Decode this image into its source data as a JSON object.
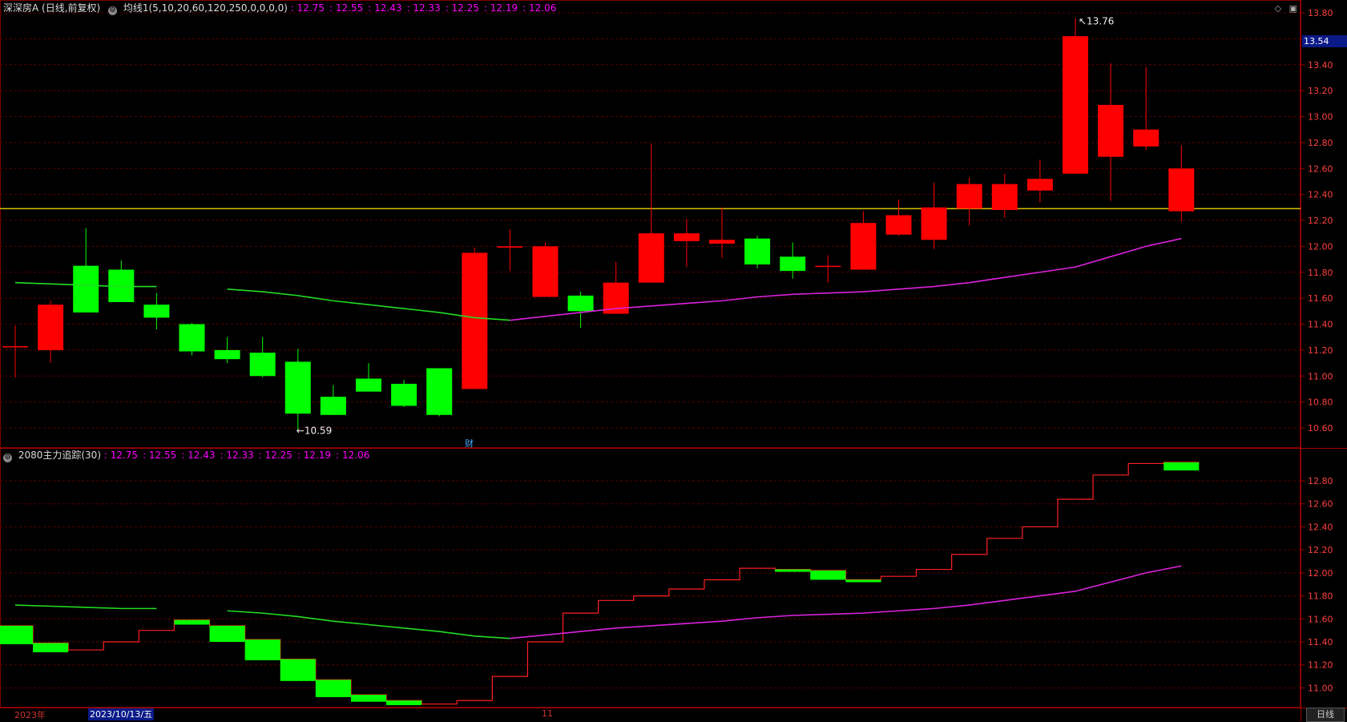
{
  "header": {
    "stock_title": "深深房A (日线,前复权)",
    "ma_label": "均线1(5,10,20,60,120,250,0,0,0,0)",
    "ma_values": [
      ": 12.75",
      ": 12.55",
      ": 12.43",
      ": 12.33",
      ": 12.25",
      ": 12.19",
      ": 12.06"
    ]
  },
  "sub_header": {
    "indicator_label": "2080主力追踪(30)",
    "values": [
      ": 12.75",
      ": 12.55",
      ": 12.43",
      ": 12.33",
      ": 12.25",
      ": 12.19",
      ": 12.06"
    ]
  },
  "price_badge": "13.54",
  "high_marker": "13.76",
  "low_marker": "10.59",
  "finance_mark": "财",
  "footer": {
    "year": "2023年",
    "date": "2023/10/13/五",
    "month": "11",
    "period": "日线"
  },
  "colors": {
    "up": "#ff0000",
    "down": "#00ff00",
    "ma_green": "#22dd22",
    "ma_magenta": "#dd22dd",
    "hline": "#d8c000",
    "grid": "#5a0000",
    "axis_text": "#ff4040"
  },
  "chart_data": [
    {
      "type": "candlestick",
      "y_ticks": [
        "13.80",
        "13.60",
        "13.40",
        "13.20",
        "13.00",
        "12.80",
        "12.60",
        "12.40",
        "12.20",
        "12.00",
        "11.80",
        "11.60",
        "11.40",
        "11.20",
        "11.00",
        "10.80",
        "10.60"
      ],
      "ylim": [
        10.45,
        13.88
      ],
      "hline": 12.29,
      "candles": [
        {
          "o": 11.23,
          "h": 11.39,
          "l": 10.99,
          "c": 11.23
        },
        {
          "o": 11.2,
          "h": 11.58,
          "l": 11.1,
          "c": 11.55
        },
        {
          "o": 11.85,
          "h": 12.14,
          "l": 11.49,
          "c": 11.49
        },
        {
          "o": 11.82,
          "h": 11.89,
          "l": 11.57,
          "c": 11.57
        },
        {
          "o": 11.55,
          "h": 11.64,
          "l": 11.36,
          "c": 11.45
        },
        {
          "o": 11.4,
          "h": 11.41,
          "l": 11.16,
          "c": 11.19
        },
        {
          "o": 11.2,
          "h": 11.3,
          "l": 11.1,
          "c": 11.13
        },
        {
          "o": 11.18,
          "h": 11.3,
          "l": 10.99,
          "c": 11.0
        },
        {
          "o": 11.11,
          "h": 11.21,
          "l": 10.59,
          "c": 10.71
        },
        {
          "o": 10.84,
          "h": 10.93,
          "l": 10.7,
          "c": 10.7
        },
        {
          "o": 10.98,
          "h": 11.1,
          "l": 10.88,
          "c": 10.88
        },
        {
          "o": 10.94,
          "h": 10.97,
          "l": 10.76,
          "c": 10.77
        },
        {
          "o": 11.06,
          "h": 11.06,
          "l": 10.69,
          "c": 10.7
        },
        {
          "o": 10.9,
          "h": 11.99,
          "l": 10.9,
          "c": 11.95
        },
        {
          "o": 11.99,
          "h": 12.13,
          "l": 11.81,
          "c": 12.0
        },
        {
          "o": 11.61,
          "h": 12.03,
          "l": 11.61,
          "c": 12.0
        },
        {
          "o": 11.62,
          "h": 11.65,
          "l": 11.37,
          "c": 11.5
        },
        {
          "o": 11.48,
          "h": 11.88,
          "l": 11.48,
          "c": 11.72
        },
        {
          "o": 11.72,
          "h": 12.79,
          "l": 11.72,
          "c": 12.1
        },
        {
          "o": 12.04,
          "h": 12.21,
          "l": 11.84,
          "c": 12.1
        },
        {
          "o": 12.02,
          "h": 12.3,
          "l": 11.91,
          "c": 12.05
        },
        {
          "o": 12.06,
          "h": 12.08,
          "l": 11.83,
          "c": 11.86
        },
        {
          "o": 11.92,
          "h": 12.03,
          "l": 11.75,
          "c": 11.81
        },
        {
          "o": 11.85,
          "h": 11.93,
          "l": 11.72,
          "c": 11.85
        },
        {
          "o": 11.82,
          "h": 12.27,
          "l": 11.82,
          "c": 12.18
        },
        {
          "o": 12.09,
          "h": 12.36,
          "l": 12.08,
          "c": 12.24
        },
        {
          "o": 12.05,
          "h": 12.49,
          "l": 11.98,
          "c": 12.3
        },
        {
          "o": 12.29,
          "h": 12.53,
          "l": 12.16,
          "c": 12.48
        },
        {
          "o": 12.28,
          "h": 12.56,
          "l": 12.22,
          "c": 12.48
        },
        {
          "o": 12.43,
          "h": 12.67,
          "l": 12.34,
          "c": 12.52
        },
        {
          "o": 12.56,
          "h": 13.76,
          "l": 12.56,
          "c": 13.62
        },
        {
          "o": 12.69,
          "h": 13.41,
          "l": 12.35,
          "c": 13.09
        },
        {
          "o": 12.77,
          "h": 13.38,
          "l": 12.74,
          "c": 12.9
        },
        {
          "o": 12.27,
          "h": 12.78,
          "l": 12.19,
          "c": 12.6
        }
      ],
      "ma_green": [
        11.72,
        11.71,
        11.7,
        11.69,
        11.69,
        null,
        11.67,
        11.65,
        11.62,
        11.58,
        11.55,
        11.52,
        11.49,
        11.45,
        11.43
      ],
      "ma_magenta": [
        null,
        null,
        null,
        null,
        null,
        null,
        null,
        null,
        null,
        null,
        null,
        null,
        null,
        null,
        11.43,
        11.46,
        11.49,
        11.52,
        11.54,
        11.56,
        11.58,
        11.61,
        11.63,
        11.64,
        11.65,
        11.67,
        11.69,
        11.72,
        11.76,
        11.8,
        11.84,
        11.92,
        12.0,
        12.06
      ]
    },
    {
      "type": "step",
      "y_ticks": [
        "12.80",
        "12.60",
        "12.40",
        "12.20",
        "12.00",
        "11.80",
        "11.60",
        "11.40",
        "11.20",
        "11.00"
      ],
      "ylim": [
        10.85,
        13.05
      ],
      "blocks": [
        {
          "top": 11.54,
          "bot": 11.38
        },
        {
          "top": 11.39,
          "bot": 11.31
        },
        {
          "top": 11.33,
          "bot": 11.33
        },
        {
          "top": 11.4,
          "bot": 11.4
        },
        {
          "top": 11.5,
          "bot": 11.5
        },
        {
          "top": 11.59,
          "bot": 11.55
        },
        {
          "top": 11.54,
          "bot": 11.4
        },
        {
          "top": 11.42,
          "bot": 11.24
        },
        {
          "top": 11.25,
          "bot": 11.06
        },
        {
          "top": 11.07,
          "bot": 10.92
        },
        {
          "top": 10.94,
          "bot": 10.88
        },
        {
          "top": 10.89,
          "bot": 10.85
        },
        {
          "top": 10.86,
          "bot": 10.86
        },
        {
          "top": 10.89,
          "bot": 10.89
        },
        {
          "top": 11.1,
          "bot": 11.1
        },
        {
          "top": 11.4,
          "bot": 11.4
        },
        {
          "top": 11.65,
          "bot": 11.65
        },
        {
          "top": 11.76,
          "bot": 11.76
        },
        {
          "top": 11.8,
          "bot": 11.8
        },
        {
          "top": 11.86,
          "bot": 11.86
        },
        {
          "top": 11.94,
          "bot": 11.94
        },
        {
          "top": 12.04,
          "bot": 12.04
        },
        {
          "top": 12.03,
          "bot": 12.01
        },
        {
          "top": 12.02,
          "bot": 11.94
        },
        {
          "top": 11.94,
          "bot": 11.93
        },
        {
          "top": 11.97,
          "bot": 11.97
        },
        {
          "top": 12.03,
          "bot": 12.03
        },
        {
          "top": 12.16,
          "bot": 12.16
        },
        {
          "top": 12.3,
          "bot": 12.3
        },
        {
          "top": 12.4,
          "bot": 12.4
        },
        {
          "top": 12.64,
          "bot": 12.64
        },
        {
          "top": 12.85,
          "bot": 12.85
        },
        {
          "top": 12.95,
          "bot": 12.95
        },
        {
          "top": 12.96,
          "bot": 12.89
        }
      ],
      "ma_green": [
        11.72,
        11.71,
        11.7,
        11.69,
        11.69,
        null,
        11.67,
        11.65,
        11.62,
        11.58,
        11.55,
        11.52,
        11.49,
        11.45,
        11.43
      ],
      "ma_magenta": [
        null,
        null,
        null,
        null,
        null,
        null,
        null,
        null,
        null,
        null,
        null,
        null,
        null,
        null,
        11.43,
        11.46,
        11.49,
        11.52,
        11.54,
        11.56,
        11.58,
        11.61,
        11.63,
        11.64,
        11.65,
        11.67,
        11.69,
        11.72,
        11.76,
        11.8,
        11.84,
        11.92,
        12.0,
        12.06
      ]
    }
  ]
}
